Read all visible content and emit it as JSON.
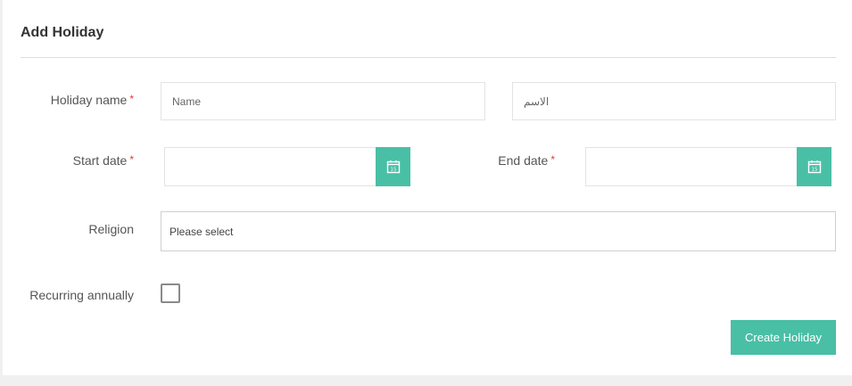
{
  "form": {
    "title": "Add Holiday",
    "holiday_name_label": "Holiday name",
    "required_mark": "*",
    "name_placeholder": "Name",
    "name_ar_placeholder": "الاسم",
    "start_date_label": "Start date",
    "end_date_label": "End date",
    "calendar_day": "15",
    "religion_label": "Religion",
    "religion_value": "Please select",
    "recurring_label": "Recurring annually",
    "recurring_checked": false,
    "submit_label": "Create Holiday"
  },
  "colors": {
    "accent": "#49bfa6",
    "required": "#e53935"
  },
  "icons": {
    "calendar": "calendar-icon"
  }
}
